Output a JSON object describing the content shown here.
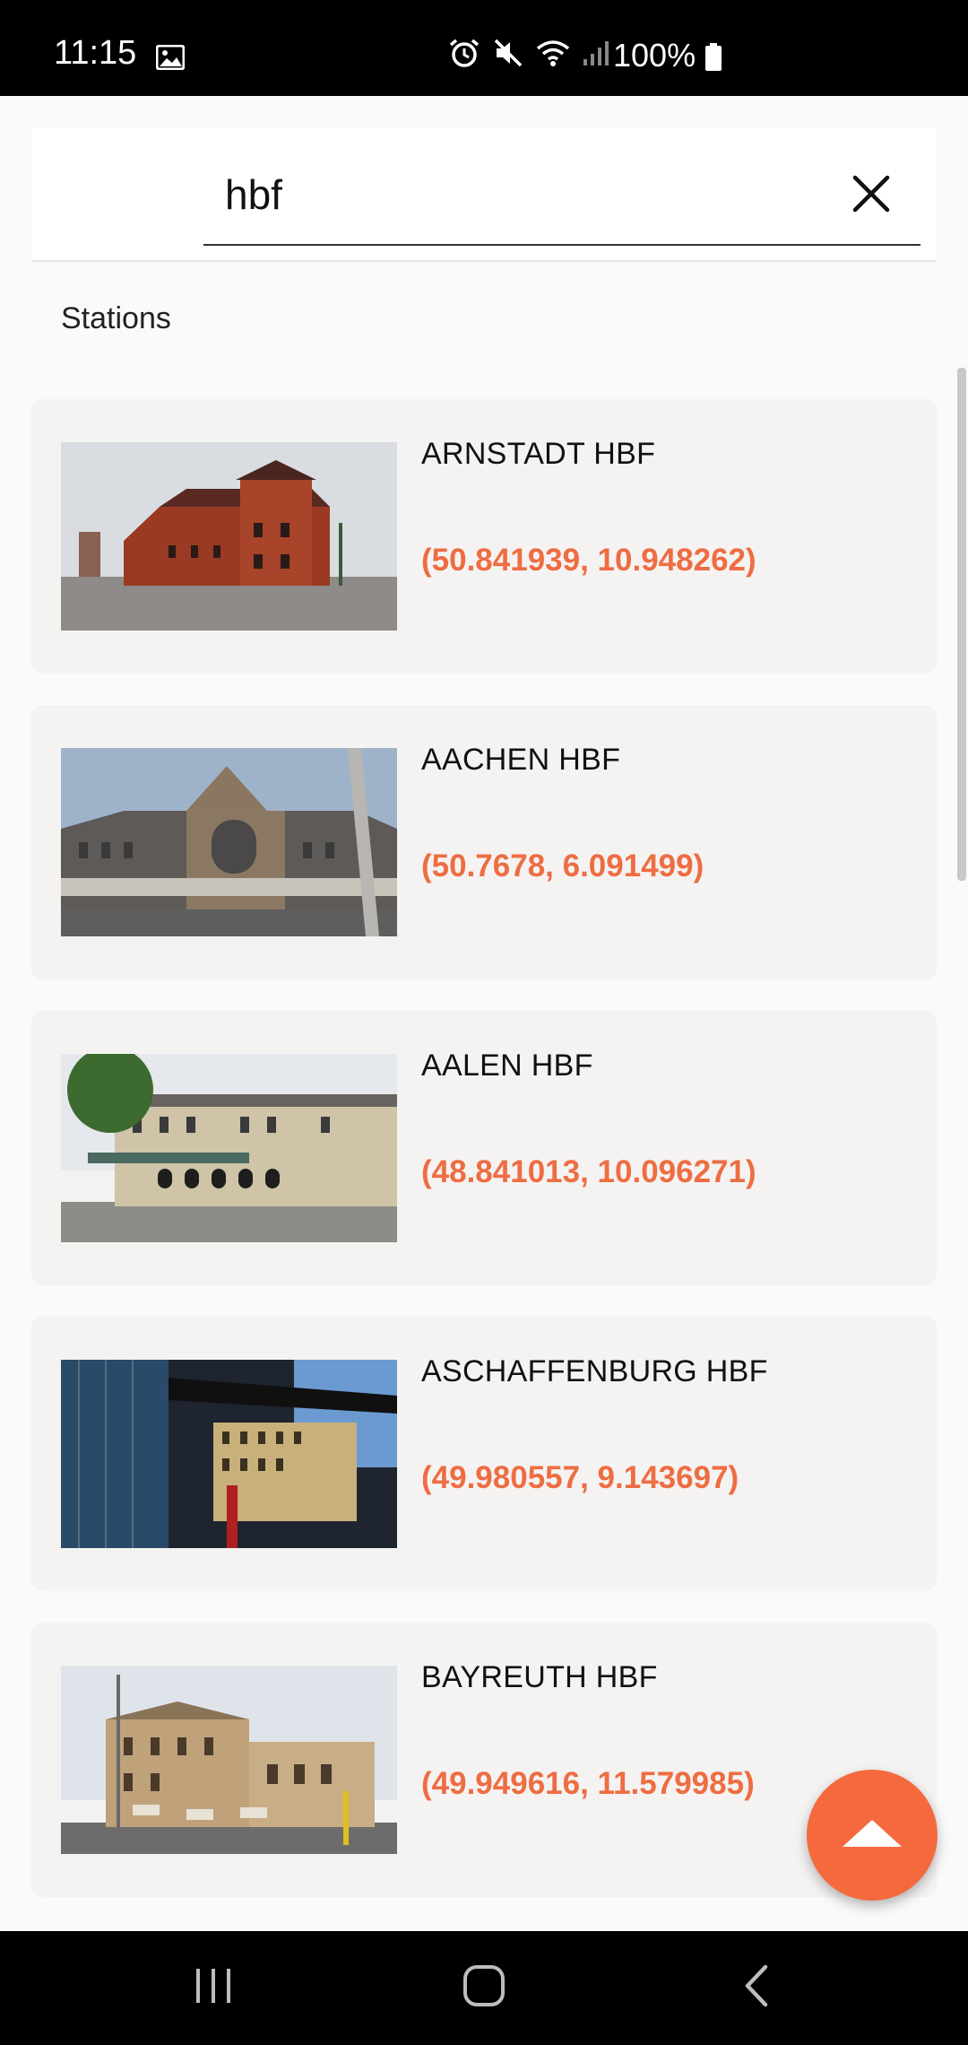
{
  "status_bar": {
    "time": "11:15",
    "battery_text": "100%",
    "icons": [
      "gallery-icon",
      "alarm-icon",
      "mute-icon",
      "wifi-icon",
      "signal-icon",
      "battery-icon"
    ]
  },
  "search": {
    "value": "hbf",
    "clear_icon": "close-icon"
  },
  "section_title": "Stations",
  "stations": [
    {
      "name": "ARNSTADT HBF",
      "coords": "(50.841939, 10.948262)"
    },
    {
      "name": "AACHEN HBF",
      "coords": "(50.7678, 6.091499)"
    },
    {
      "name": "AALEN HBF",
      "coords": "(48.841013, 10.096271)"
    },
    {
      "name": "ASCHAFFENBURG HBF",
      "coords": "(49.980557, 9.143697)"
    },
    {
      "name": "BAYREUTH HBF",
      "coords": "(49.949616, 11.579985)"
    }
  ],
  "fab": {
    "icon": "arrow-up-icon"
  },
  "nav_bar": {
    "icons": [
      "recent-apps-icon",
      "home-icon",
      "back-icon"
    ]
  },
  "colors": {
    "accent": "#f46a3e",
    "coords_text": "#ee6d42",
    "card_bg": "#f4f3f2",
    "status_bar_bg": "#000000"
  }
}
